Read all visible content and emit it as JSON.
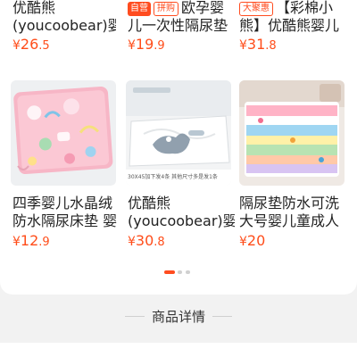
{
  "top_row": [
    {
      "badges": [],
      "title_line": "优酷熊",
      "title_line2": "(youcoobear)婴",
      "price_int": "26",
      "price_dec": ".5"
    },
    {
      "badges": [
        "自营",
        "拼购"
      ],
      "title_line": "欧孕婴",
      "title_line2": "儿一次性隔尿垫",
      "price_int": "19",
      "price_dec": ".9"
    },
    {
      "badges": [
        "大聚惠"
      ],
      "title_line": "【彩棉小",
      "title_line2": "熊】优酷熊婴儿",
      "price_int": "31",
      "price_dec": ".8"
    }
  ],
  "products": [
    {
      "line1": "四季婴儿水晶绒",
      "line2": "防水隔尿床垫 婴",
      "price_int": "12",
      "price_dec": ".9"
    },
    {
      "line1": "优酷熊",
      "line2": "(youcoobear)婴",
      "price_int": "30",
      "price_dec": ".8",
      "image_caption": "30X45加下发4条 其他尺寸多是发1条"
    },
    {
      "line1": "隔尿垫防水可洗",
      "line2": "大号婴儿童成人",
      "price_int": "20",
      "price_dec": ""
    }
  ],
  "currency": "¥",
  "pager": {
    "count": 3,
    "active": 0
  },
  "section_title": "商品详情",
  "colors": {
    "accent": "#ff4d1a",
    "pager_active": "#ff4c1f",
    "pager_inactive": "#d0d0d0"
  }
}
